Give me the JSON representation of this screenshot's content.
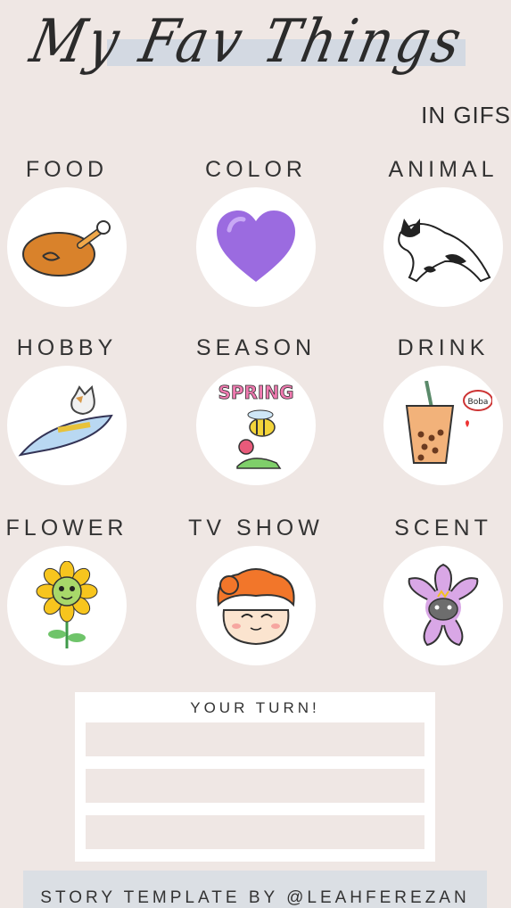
{
  "header": {
    "title": "My Fav Things",
    "subtitle": "IN GIFS"
  },
  "categories": [
    {
      "label": "FOOD",
      "icon": "roast-chicken-icon"
    },
    {
      "label": "COLOR",
      "icon": "purple-heart-icon"
    },
    {
      "label": "ANIMAL",
      "icon": "cat-icon"
    },
    {
      "label": "HOBBY",
      "icon": "cat-riding-fish-icon"
    },
    {
      "label": "SEASON",
      "icon": "spring-bee-icon",
      "sticker_text": "SPRING"
    },
    {
      "label": "DRINK",
      "icon": "boba-tea-icon",
      "sticker_text": "Boba"
    },
    {
      "label": "FLOWER",
      "icon": "sunflower-icon"
    },
    {
      "label": "TV SHOW",
      "icon": "hamster-icon"
    },
    {
      "label": "SCENT",
      "icon": "cherry-blossom-icon"
    }
  ],
  "your_turn": {
    "label": "YOUR TURN!"
  },
  "footer": {
    "credit": "STORY TEMPLATE BY @LEAHFEREZAN"
  },
  "colors": {
    "background": "#efe7e4",
    "highlight": "#d3d9e2",
    "heart": "#9b6be0"
  }
}
